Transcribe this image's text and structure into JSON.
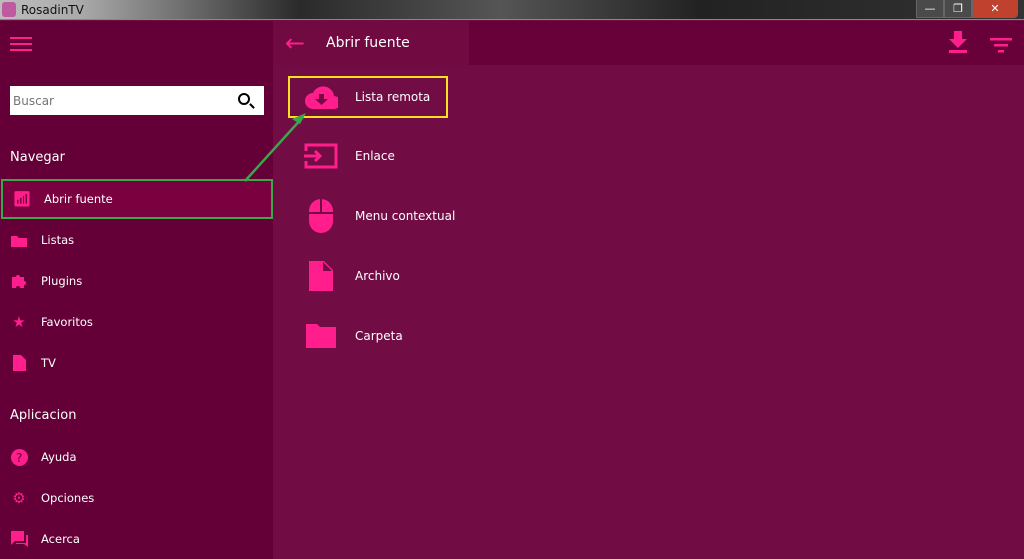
{
  "window": {
    "title": "RosadinTV",
    "minimize": "—",
    "maximize": "❐",
    "close": "✕"
  },
  "sidebar": {
    "search_placeholder": "Buscar",
    "sections": {
      "navegar": "Navegar",
      "aplicacion": "Aplicacion"
    },
    "nav_items": [
      {
        "label": "Abrir fuente",
        "icon": "wifi-icon"
      },
      {
        "label": "Listas",
        "icon": "folder-icon"
      },
      {
        "label": "Plugins",
        "icon": "puzzle-icon"
      },
      {
        "label": "Favoritos",
        "icon": "star-icon"
      },
      {
        "label": "TV",
        "icon": "file-icon"
      }
    ],
    "app_items": [
      {
        "label": "Ayuda",
        "icon": "help-icon"
      },
      {
        "label": "Opciones",
        "icon": "gear-icon"
      },
      {
        "label": "Acerca",
        "icon": "chat-icon"
      }
    ]
  },
  "header": {
    "title": "Abrir fuente"
  },
  "main": {
    "items": [
      {
        "label": "Lista remota",
        "icon": "cloud-download-icon"
      },
      {
        "label": "Enlace",
        "icon": "input-icon"
      },
      {
        "label": "Menu contextual",
        "icon": "mouse-icon"
      },
      {
        "label": "Archivo",
        "icon": "file-icon"
      },
      {
        "label": "Carpeta",
        "icon": "folder-icon"
      }
    ]
  },
  "colors": {
    "accent": "#ff1e8c",
    "sidebar": "#640037",
    "main": "#720c44",
    "highlight_green": "#3aa84a",
    "highlight_yellow": "#ffe020"
  }
}
